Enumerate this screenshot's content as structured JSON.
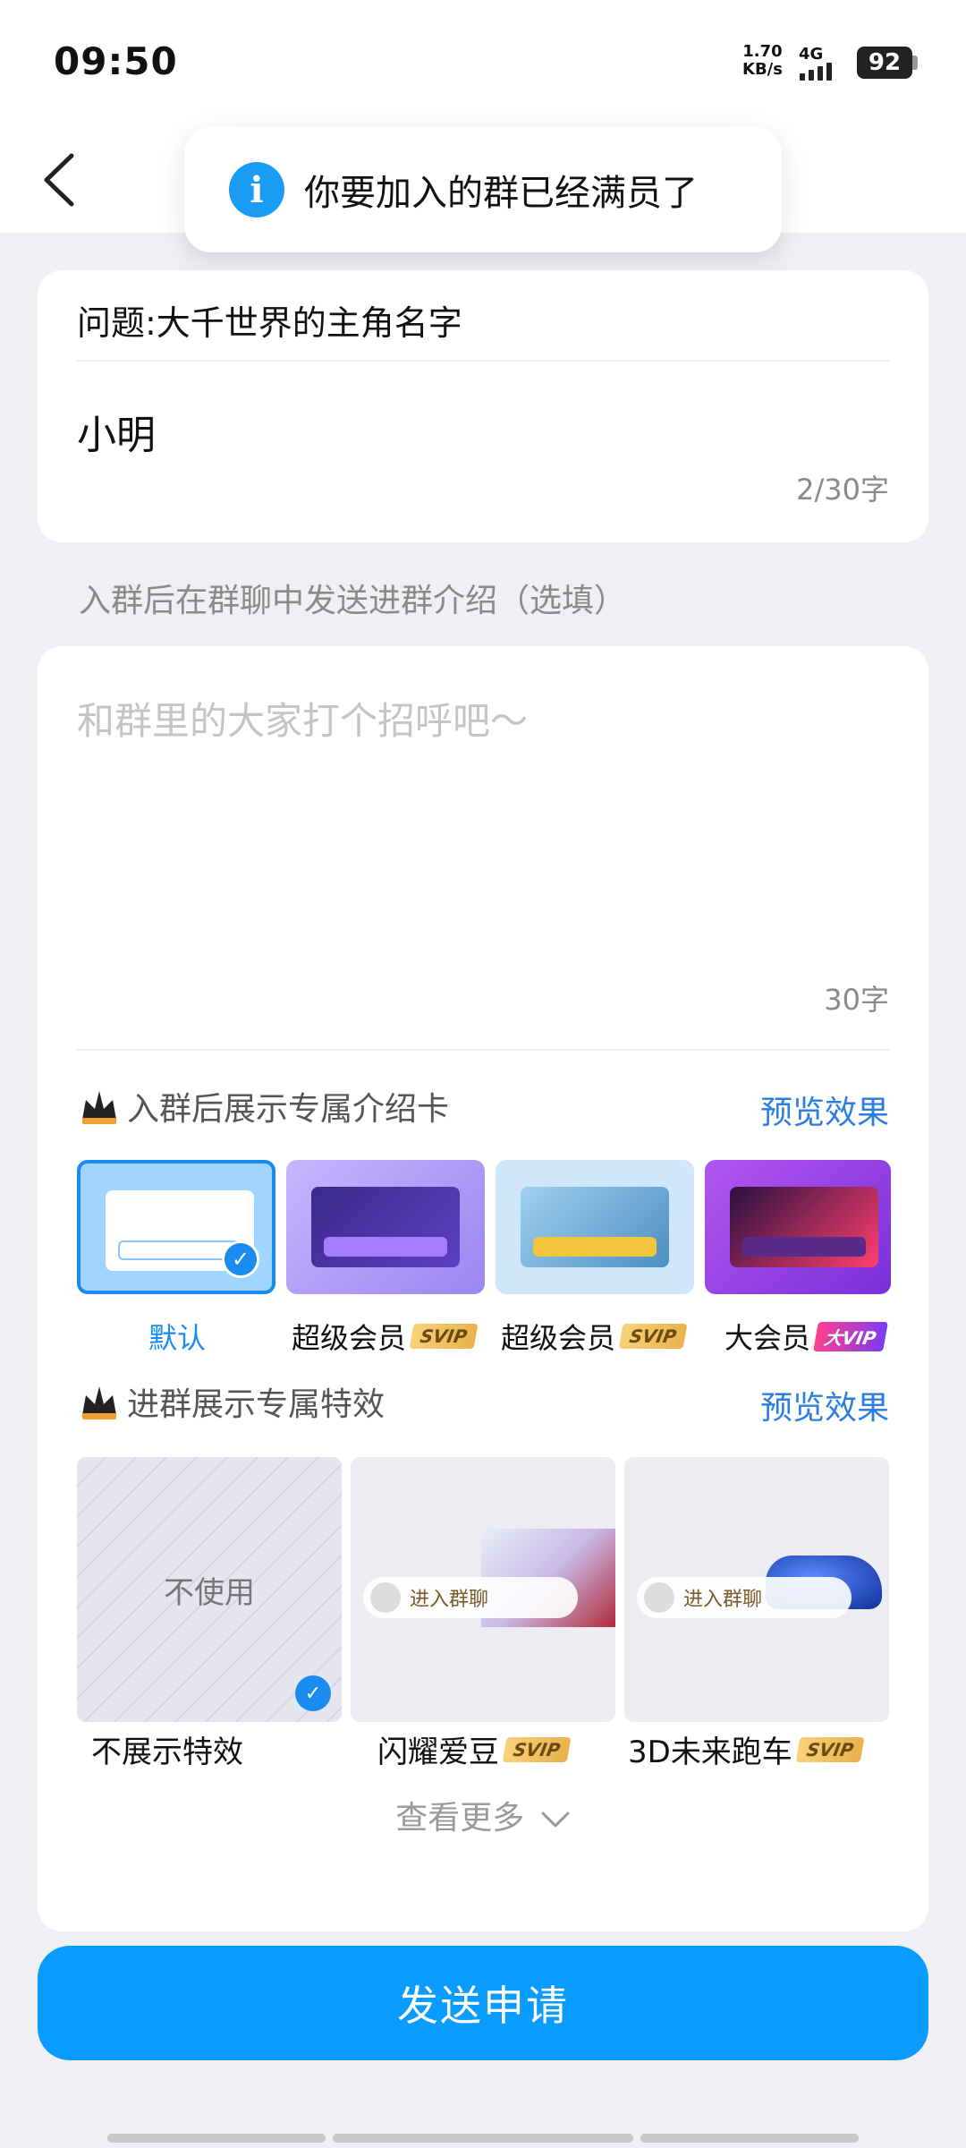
{
  "status_bar": {
    "time": "09:50",
    "net_speed_value": "1.70",
    "net_speed_unit": "KB/s",
    "network": "4G",
    "battery": "92"
  },
  "toast": {
    "icon": "info-icon",
    "message": "你要加入的群已经满员了"
  },
  "question_card": {
    "question": "问题:大千世界的主角名字",
    "answer": "小明",
    "counter": "2/30字"
  },
  "intro_section_label": "入群后在群聊中发送进群介绍（选填）",
  "intro": {
    "placeholder": "和群里的大家打个招呼吧～",
    "counter": "30字"
  },
  "intro_card_section": {
    "title": "入群后展示专属介绍卡",
    "preview": "预览效果",
    "items": [
      {
        "label": "默认",
        "badge": "",
        "selected": true
      },
      {
        "label": "超级会员",
        "badge": "SVIP",
        "selected": false
      },
      {
        "label": "超级会员",
        "badge": "SVIP",
        "selected": false
      },
      {
        "label": "大会员",
        "badge": "大VIP",
        "selected": false
      }
    ]
  },
  "effect_section": {
    "title": "进群展示专属特效",
    "preview": "预览效果",
    "none_text": "不使用",
    "join_text": "进入群聊",
    "items": [
      {
        "label": "不展示特效",
        "badge": "",
        "selected": true
      },
      {
        "label": "闪耀爱豆",
        "badge": "SVIP",
        "selected": false
      },
      {
        "label": "3D未来跑车",
        "badge": "SVIP",
        "selected": false
      }
    ]
  },
  "see_more": "查看更多",
  "submit_button": "发送申请",
  "colors": {
    "accent": "#0a9bff",
    "link": "#2a7ee0",
    "background": "#efeff4"
  }
}
